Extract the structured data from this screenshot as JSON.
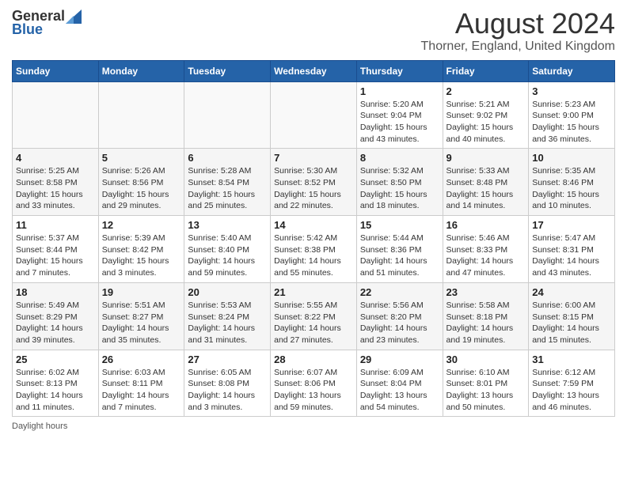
{
  "header": {
    "logo_general": "General",
    "logo_blue": "Blue",
    "title": "August 2024",
    "subtitle": "Thorner, England, United Kingdom"
  },
  "weekdays": [
    "Sunday",
    "Monday",
    "Tuesday",
    "Wednesday",
    "Thursday",
    "Friday",
    "Saturday"
  ],
  "weeks": [
    [
      {
        "day": "",
        "info": ""
      },
      {
        "day": "",
        "info": ""
      },
      {
        "day": "",
        "info": ""
      },
      {
        "day": "",
        "info": ""
      },
      {
        "day": "1",
        "info": "Sunrise: 5:20 AM\nSunset: 9:04 PM\nDaylight: 15 hours\nand 43 minutes."
      },
      {
        "day": "2",
        "info": "Sunrise: 5:21 AM\nSunset: 9:02 PM\nDaylight: 15 hours\nand 40 minutes."
      },
      {
        "day": "3",
        "info": "Sunrise: 5:23 AM\nSunset: 9:00 PM\nDaylight: 15 hours\nand 36 minutes."
      }
    ],
    [
      {
        "day": "4",
        "info": "Sunrise: 5:25 AM\nSunset: 8:58 PM\nDaylight: 15 hours\nand 33 minutes."
      },
      {
        "day": "5",
        "info": "Sunrise: 5:26 AM\nSunset: 8:56 PM\nDaylight: 15 hours\nand 29 minutes."
      },
      {
        "day": "6",
        "info": "Sunrise: 5:28 AM\nSunset: 8:54 PM\nDaylight: 15 hours\nand 25 minutes."
      },
      {
        "day": "7",
        "info": "Sunrise: 5:30 AM\nSunset: 8:52 PM\nDaylight: 15 hours\nand 22 minutes."
      },
      {
        "day": "8",
        "info": "Sunrise: 5:32 AM\nSunset: 8:50 PM\nDaylight: 15 hours\nand 18 minutes."
      },
      {
        "day": "9",
        "info": "Sunrise: 5:33 AM\nSunset: 8:48 PM\nDaylight: 15 hours\nand 14 minutes."
      },
      {
        "day": "10",
        "info": "Sunrise: 5:35 AM\nSunset: 8:46 PM\nDaylight: 15 hours\nand 10 minutes."
      }
    ],
    [
      {
        "day": "11",
        "info": "Sunrise: 5:37 AM\nSunset: 8:44 PM\nDaylight: 15 hours\nand 7 minutes."
      },
      {
        "day": "12",
        "info": "Sunrise: 5:39 AM\nSunset: 8:42 PM\nDaylight: 15 hours\nand 3 minutes."
      },
      {
        "day": "13",
        "info": "Sunrise: 5:40 AM\nSunset: 8:40 PM\nDaylight: 14 hours\nand 59 minutes."
      },
      {
        "day": "14",
        "info": "Sunrise: 5:42 AM\nSunset: 8:38 PM\nDaylight: 14 hours\nand 55 minutes."
      },
      {
        "day": "15",
        "info": "Sunrise: 5:44 AM\nSunset: 8:36 PM\nDaylight: 14 hours\nand 51 minutes."
      },
      {
        "day": "16",
        "info": "Sunrise: 5:46 AM\nSunset: 8:33 PM\nDaylight: 14 hours\nand 47 minutes."
      },
      {
        "day": "17",
        "info": "Sunrise: 5:47 AM\nSunset: 8:31 PM\nDaylight: 14 hours\nand 43 minutes."
      }
    ],
    [
      {
        "day": "18",
        "info": "Sunrise: 5:49 AM\nSunset: 8:29 PM\nDaylight: 14 hours\nand 39 minutes."
      },
      {
        "day": "19",
        "info": "Sunrise: 5:51 AM\nSunset: 8:27 PM\nDaylight: 14 hours\nand 35 minutes."
      },
      {
        "day": "20",
        "info": "Sunrise: 5:53 AM\nSunset: 8:24 PM\nDaylight: 14 hours\nand 31 minutes."
      },
      {
        "day": "21",
        "info": "Sunrise: 5:55 AM\nSunset: 8:22 PM\nDaylight: 14 hours\nand 27 minutes."
      },
      {
        "day": "22",
        "info": "Sunrise: 5:56 AM\nSunset: 8:20 PM\nDaylight: 14 hours\nand 23 minutes."
      },
      {
        "day": "23",
        "info": "Sunrise: 5:58 AM\nSunset: 8:18 PM\nDaylight: 14 hours\nand 19 minutes."
      },
      {
        "day": "24",
        "info": "Sunrise: 6:00 AM\nSunset: 8:15 PM\nDaylight: 14 hours\nand 15 minutes."
      }
    ],
    [
      {
        "day": "25",
        "info": "Sunrise: 6:02 AM\nSunset: 8:13 PM\nDaylight: 14 hours\nand 11 minutes."
      },
      {
        "day": "26",
        "info": "Sunrise: 6:03 AM\nSunset: 8:11 PM\nDaylight: 14 hours\nand 7 minutes."
      },
      {
        "day": "27",
        "info": "Sunrise: 6:05 AM\nSunset: 8:08 PM\nDaylight: 14 hours\nand 3 minutes."
      },
      {
        "day": "28",
        "info": "Sunrise: 6:07 AM\nSunset: 8:06 PM\nDaylight: 13 hours\nand 59 minutes."
      },
      {
        "day": "29",
        "info": "Sunrise: 6:09 AM\nSunset: 8:04 PM\nDaylight: 13 hours\nand 54 minutes."
      },
      {
        "day": "30",
        "info": "Sunrise: 6:10 AM\nSunset: 8:01 PM\nDaylight: 13 hours\nand 50 minutes."
      },
      {
        "day": "31",
        "info": "Sunrise: 6:12 AM\nSunset: 7:59 PM\nDaylight: 13 hours\nand 46 minutes."
      }
    ]
  ],
  "footer": {
    "daylight_hours": "Daylight hours"
  }
}
